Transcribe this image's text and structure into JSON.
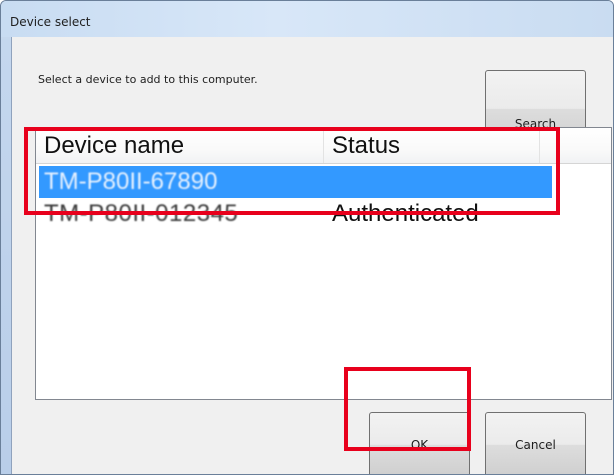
{
  "window": {
    "title": "Device select"
  },
  "dialog": {
    "instruction": "Select a device to add to this computer."
  },
  "buttons": {
    "search": "Search",
    "ok": "OK",
    "cancel": "Cancel"
  },
  "listview": {
    "columns": [
      "Device name",
      "Status"
    ],
    "rows": [
      {
        "name": "TM-P80II-67890",
        "status": "",
        "selected": true
      },
      {
        "name": "TM-P80II-012345",
        "status": "Authenticated",
        "selected": false
      }
    ]
  },
  "colors": {
    "selection": "#3399ff",
    "highlight_box": "#e8001c",
    "title_bar": "#c8dcf2"
  }
}
